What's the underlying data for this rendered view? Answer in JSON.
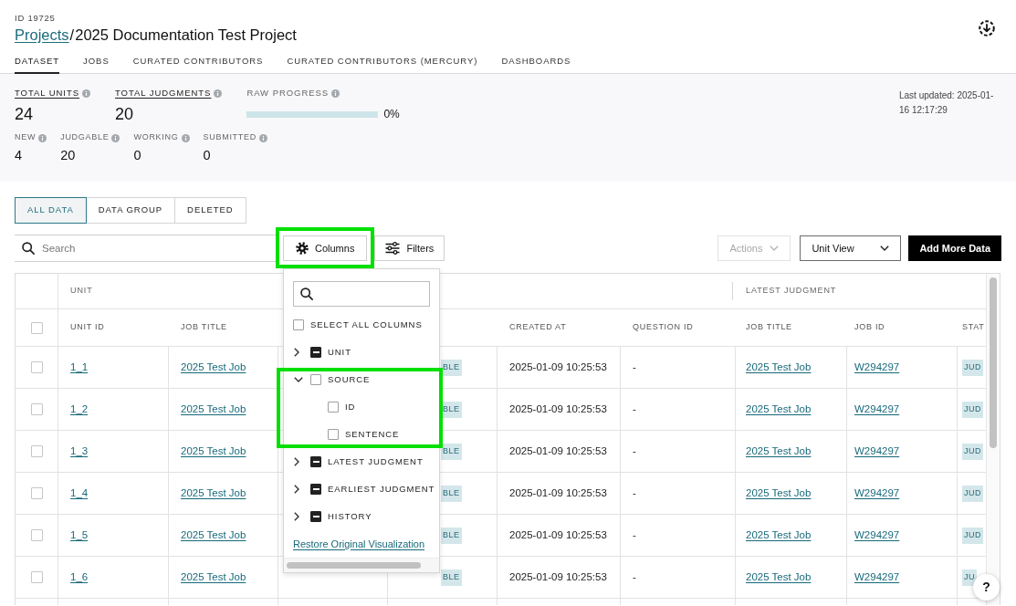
{
  "header": {
    "project_id": "ID 19725",
    "breadcrumb": {
      "link": "Projects",
      "separator": "/",
      "current": "2025 Documentation Test Project"
    },
    "tabs": [
      {
        "label": "DATASET",
        "selected": true
      },
      {
        "label": "JOBS",
        "selected": false
      },
      {
        "label": "CURATED CONTRIBUTORS",
        "selected": false
      },
      {
        "label": "CURATED CONTRIBUTORS (MERCURY)",
        "selected": false
      },
      {
        "label": "DASHBOARDS",
        "selected": false
      }
    ]
  },
  "summary": {
    "totals": [
      {
        "kind": "link",
        "label": "TOTAL UNITS",
        "value": "24"
      },
      {
        "kind": "link",
        "label": "TOTAL JUDGMENTS",
        "value": "20"
      },
      {
        "kind": "progress",
        "label": "RAW PROGRESS",
        "level": 0,
        "reading": "0%"
      }
    ],
    "counts": [
      {
        "label": "NEW",
        "value": "4"
      },
      {
        "label": "JUDGABLE",
        "value": "20"
      },
      {
        "label": "WORKING",
        "value": "0"
      },
      {
        "label": "SUBMITTED",
        "value": "0"
      }
    ],
    "last_updated": "Last updated: 2025-01-16 12:17:29"
  },
  "views": [
    {
      "label": "ALL DATA",
      "selected": true
    },
    {
      "label": "DATA GROUP",
      "selected": false
    },
    {
      "label": "DELETED",
      "selected": false
    }
  ],
  "toolbar": {
    "search": {
      "placeholder": "Search"
    },
    "columns_button": {
      "label": "Columns",
      "highlighted": true
    },
    "filters_button": {
      "label": "Filters"
    },
    "actions_menu": {
      "label": "Actions",
      "disabled": true
    },
    "view_select": {
      "value": "Unit View"
    },
    "add_button": {
      "label": "Add More Data"
    }
  },
  "column_menu": {
    "select_all": {
      "label": "SELECT ALL COLUMNS",
      "checked": false
    },
    "items": [
      {
        "label": "UNIT",
        "expanded": false,
        "indeterminate": true,
        "highlighted": false
      },
      {
        "label": "SOURCE",
        "expanded": true,
        "checked": false,
        "indeterminate": false,
        "highlighted": true,
        "children": [
          {
            "label": "ID",
            "checked": false
          },
          {
            "label": "SENTENCE",
            "checked": false
          }
        ]
      },
      {
        "label": "LATEST JUDGMENT",
        "expanded": false,
        "indeterminate": true,
        "highlighted": false
      },
      {
        "label": "EARLIEST JUDGMENT",
        "expanded": false,
        "indeterminate": true,
        "highlighted": false
      },
      {
        "label": "HISTORY",
        "expanded": false,
        "indeterminate": true,
        "highlighted": false
      }
    ],
    "restore_link": "Restore Original Visualization"
  },
  "table": {
    "select_all": {
      "checked": false
    },
    "column_groups": [
      {
        "label": "UNIT",
        "columns": [
          {
            "label": "UNIT ID",
            "kind": "link"
          },
          {
            "label": "JOB TITLE",
            "kind": "link"
          },
          {
            "kind": "badge"
          },
          {
            "label": "CREATED AT",
            "kind": "text"
          },
          {
            "label": "QUESTION ID",
            "kind": "text"
          }
        ]
      },
      {
        "label": "LATEST JUDGMENT",
        "columns": [
          {
            "label": "JOB TITLE",
            "kind": "link"
          },
          {
            "label": "JOB ID",
            "kind": "link"
          },
          {
            "label": "STAT",
            "kind": "badge"
          }
        ]
      }
    ],
    "rows": [
      {
        "selected": false,
        "cells": [
          "1_1",
          "2025 Test Job",
          "BLE",
          "2025-01-09 10:25:53",
          "-",
          "2025 Test Job",
          "W294297",
          "JUD"
        ]
      },
      {
        "selected": false,
        "cells": [
          "1_2",
          "2025 Test Job",
          "BLE",
          "2025-01-09 10:25:53",
          "-",
          "2025 Test Job",
          "W294297",
          "JUD"
        ]
      },
      {
        "selected": false,
        "cells": [
          "1_3",
          "2025 Test Job",
          "BLE",
          "2025-01-09 10:25:53",
          "-",
          "2025 Test Job",
          "W294297",
          "JUD"
        ]
      },
      {
        "selected": false,
        "cells": [
          "1_4",
          "2025 Test Job",
          "BLE",
          "2025-01-09 10:25:53",
          "-",
          "2025 Test Job",
          "W294297",
          "JUD"
        ]
      },
      {
        "selected": false,
        "cells": [
          "1_5",
          "2025 Test Job",
          "BLE",
          "2025-01-09 10:25:53",
          "-",
          "2025 Test Job",
          "W294297",
          "JUD"
        ]
      },
      {
        "selected": false,
        "cells": [
          "1_6",
          "2025 Test Job",
          "BLE",
          "2025-01-09 10:25:53",
          "-",
          "2025 Test Job",
          "W294297",
          "JU"
        ]
      }
    ]
  },
  "help_button": "?"
}
